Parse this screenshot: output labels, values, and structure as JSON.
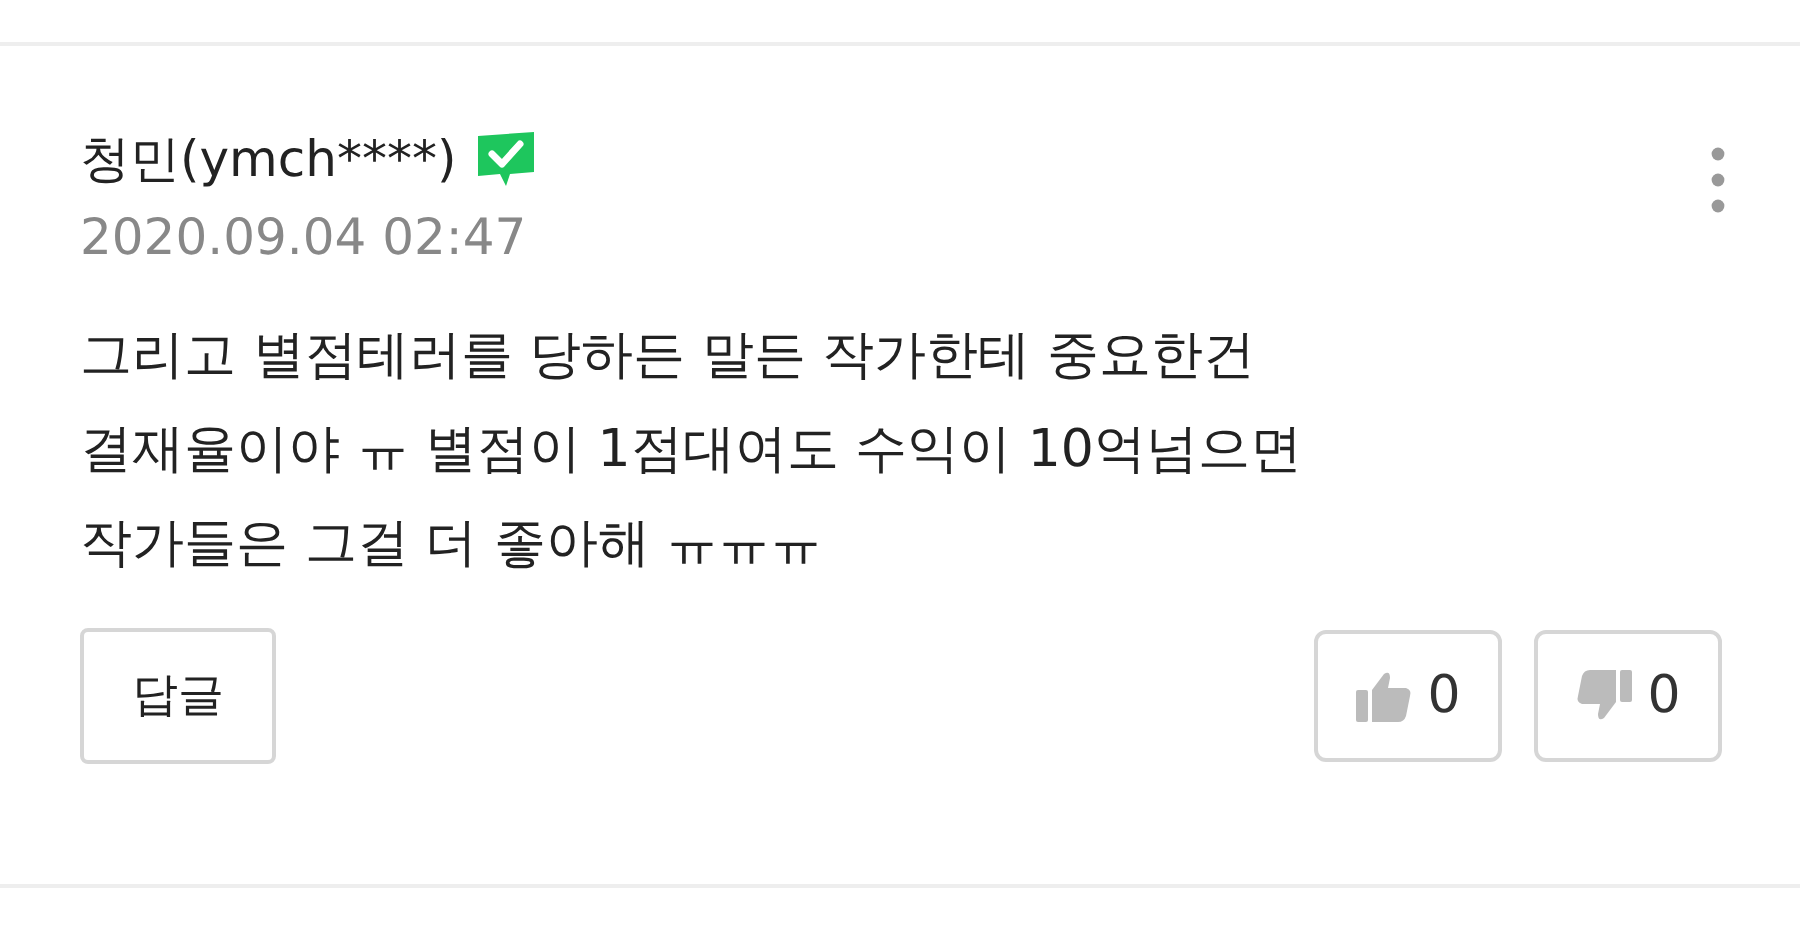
{
  "comment": {
    "author": "청민(ymch****)",
    "verified": true,
    "date": "2020.09.04 02:47",
    "body": "그리고 별점테러를 당하든 말든 작가한테 중요한건\n결재율이야 ㅠ 별점이 1점대여도 수익이 10억넘으면\n작가들은 그걸 더 좋아해 ㅠㅠㅠ",
    "reply_button": "답글",
    "likes": "0",
    "dislikes": "0"
  }
}
